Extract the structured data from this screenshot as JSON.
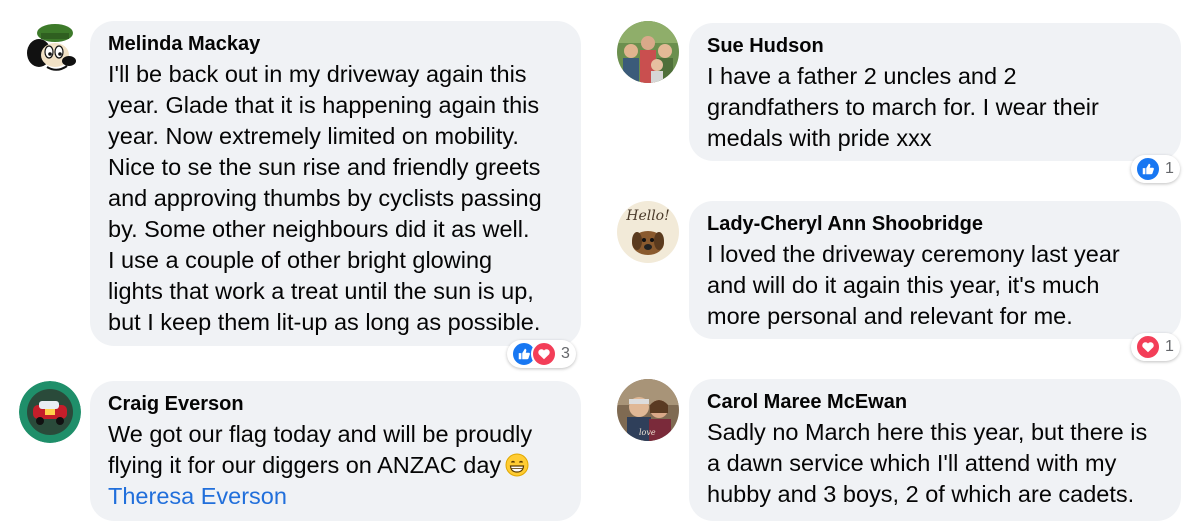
{
  "comments": [
    {
      "author": "Melinda Mackay",
      "avatar_icon": "cartoon-dog-avatar-icon",
      "lines": [
        "I'll be back out in my driveway again this",
        "year. Glade that it is happening again this",
        "year. Now extremely limited on mobility.",
        "Nice to se the sun rise and friendly greets",
        "and approving thumbs by cyclists passing",
        "by. Some other neighbours did it as well.",
        "I use a couple of other bright glowing",
        "lights that work a treat until the sun is up,",
        "but I keep them lit-up as long as possible."
      ],
      "reactions": [
        "like",
        "love"
      ],
      "reaction_count": "3"
    },
    {
      "author": "Craig Everson",
      "avatar_icon": "red-car-badge-avatar-icon",
      "lines": [
        "We got our flag today and will be proudly",
        "flying it for our diggers on ANZAC day"
      ],
      "emoji": "grinning-face-icon",
      "mention": "Theresa Everson"
    },
    {
      "author": "Sue Hudson",
      "avatar_icon": "family-photo-avatar-icon",
      "lines": [
        "I have a father 2 uncles and 2",
        "grandfathers to march for. I wear their",
        "medals with pride xxx"
      ],
      "reactions": [
        "like"
      ],
      "reaction_count": "1"
    },
    {
      "author": "Lady-Cheryl Ann Shoobridge",
      "avatar_icon": "hello-dog-avatar-icon",
      "avatar_text": "Hello!",
      "lines": [
        "I loved the driveway ceremony last year",
        "and will do it again this year, it's much",
        "more personal and relevant for me."
      ],
      "reactions": [
        "love"
      ],
      "reaction_count": "1"
    },
    {
      "author": "Carol Maree McEwan",
      "avatar_icon": "couple-photo-avatar-icon",
      "lines": [
        "Sadly no March here this year, but there is",
        "a dawn service which I'll attend with my",
        "hubby and 3 boys, 2 of which are cadets."
      ]
    }
  ],
  "colors": {
    "bubble": "#f0f2f5",
    "like": "#1877f2",
    "love": "#f33e58",
    "mention": "#216fdb"
  }
}
